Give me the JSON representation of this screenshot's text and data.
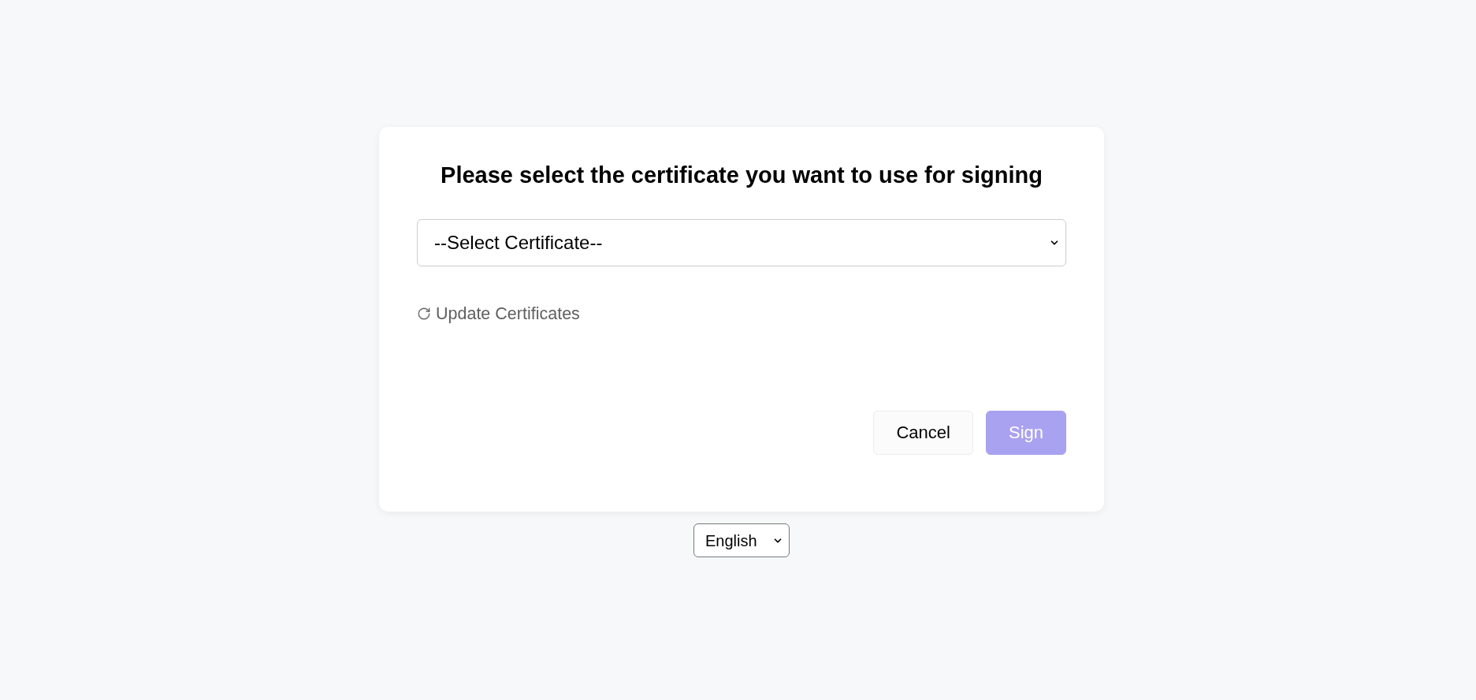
{
  "certificate_dialog": {
    "title": "Please select the certificate you want to use for signing",
    "certificate_select": {
      "value": "--Select Certificate--"
    },
    "update_link": {
      "label": "Update Certificates"
    },
    "buttons": [
      {
        "label": "Cancel",
        "kind": "secondary",
        "disabled": false
      },
      {
        "label": "Sign",
        "kind": "primary",
        "disabled": true
      }
    ]
  },
  "language_select": {
    "value": "English"
  }
}
